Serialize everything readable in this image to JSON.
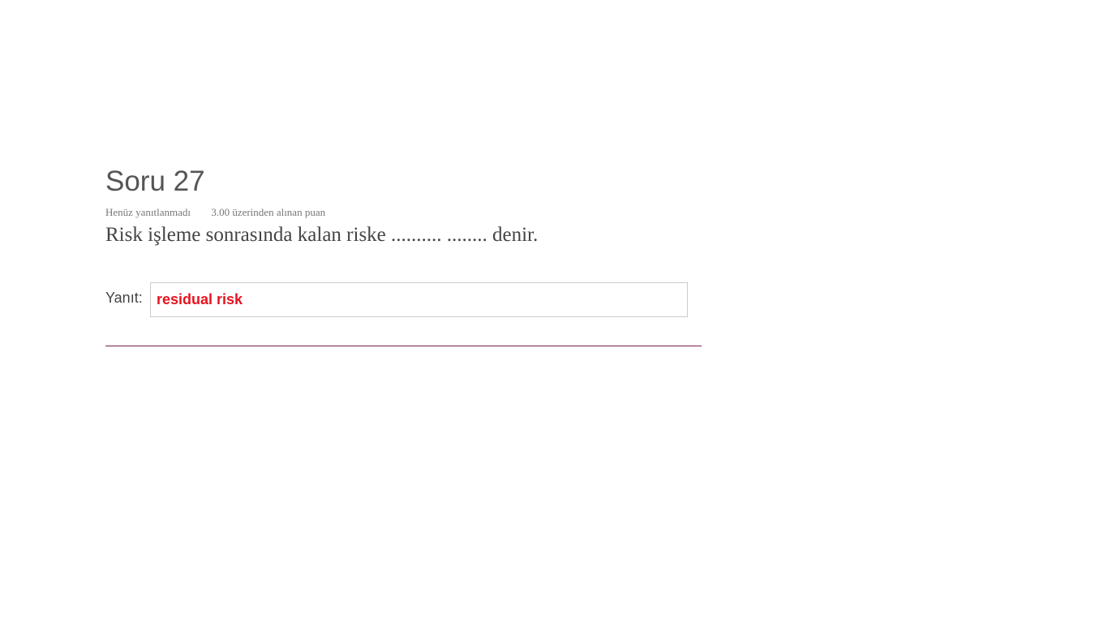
{
  "question": {
    "title": "Soru 27",
    "status": "Henüz yanıtlanmadı",
    "grade": "3.00 üzerinden alınan puan",
    "text": "Risk işleme sonrasında kalan riske .......... ........ denir.",
    "answer_label": "Yanıt:",
    "answer_value": "residual risk"
  },
  "colors": {
    "answer_text": "#e8121f",
    "divider": "#7a1f4f",
    "title": "#555555"
  }
}
